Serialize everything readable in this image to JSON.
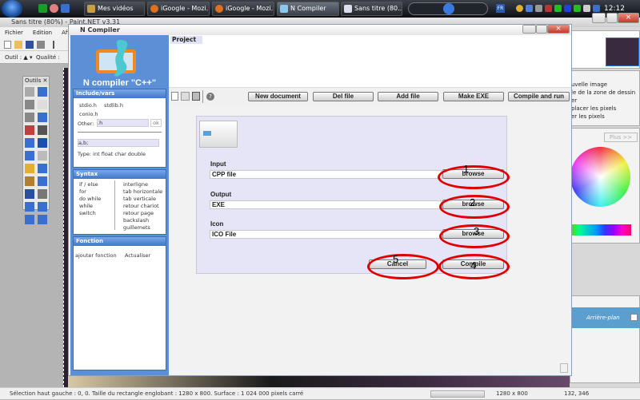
{
  "taskbar": {
    "tasks": [
      "Mes vidéos",
      "iGoogle - Mozi...",
      "iGoogle - Mozi...",
      "N Compiler",
      "Sans titre (80..."
    ],
    "lang": "FR",
    "clock": "12:12"
  },
  "paint": {
    "title": "Sans titre (80%) - Paint.NET v3.31",
    "menu": [
      "Fichier",
      "Edition",
      "Affich"
    ],
    "tool_label": "Outil :",
    "quality_label": "Qualité :",
    "tools_title": "Outils",
    "history_items": [
      "uvelle image",
      "le de la zone de dessin",
      "er",
      "placer les pixels",
      "er les pixels"
    ],
    "colors_more": "Plus >>",
    "layer_name": "Arrière-plan",
    "status": "Sélection haut gauche : 0, 0. Taille du rectangle englobant : 1280 x 800. Surface : 1 024 000 pixels carré",
    "size": "1280 x 800",
    "cursor": "132, 346"
  },
  "ncompiler": {
    "window_title": "N Compiler",
    "app_title": "N compiler \"C++\"",
    "include": {
      "header": "Include/vars",
      "items": [
        "stdio.h",
        "stdlib.h",
        "conio.h"
      ],
      "other_label": "Other:",
      "other_value": ".h",
      "ok": "ok",
      "vars_value": "a,b;",
      "types": "Type: int  float  char  double"
    },
    "syntax": {
      "header": "Syntax",
      "left": [
        "if / else",
        "for",
        "do while",
        "while",
        "switch"
      ],
      "right": [
        "interligne",
        "tab horizontale",
        "tab verticale",
        "retour chariot",
        "retour page",
        "backslash",
        "guillemets"
      ]
    },
    "fonction": {
      "header": "Fonction",
      "add": "ajouter fonction",
      "refresh": "Actualiser"
    },
    "project_tab": "Project",
    "toolbar": [
      "New  document",
      "Del file",
      "Add file",
      "Make EXE",
      "Compile and run"
    ],
    "dialog": {
      "input_label": "Input",
      "input_value": "CPP file",
      "output_label": "Output",
      "output_value": "EXE",
      "icon_label": "Icon",
      "icon_value": "ICO File",
      "browse": "browse",
      "cancel": "Cancel",
      "compile": "Compile"
    },
    "annotations": [
      "1",
      "2",
      "3",
      "4",
      "5"
    ],
    "annotation_color": "#e00000"
  }
}
